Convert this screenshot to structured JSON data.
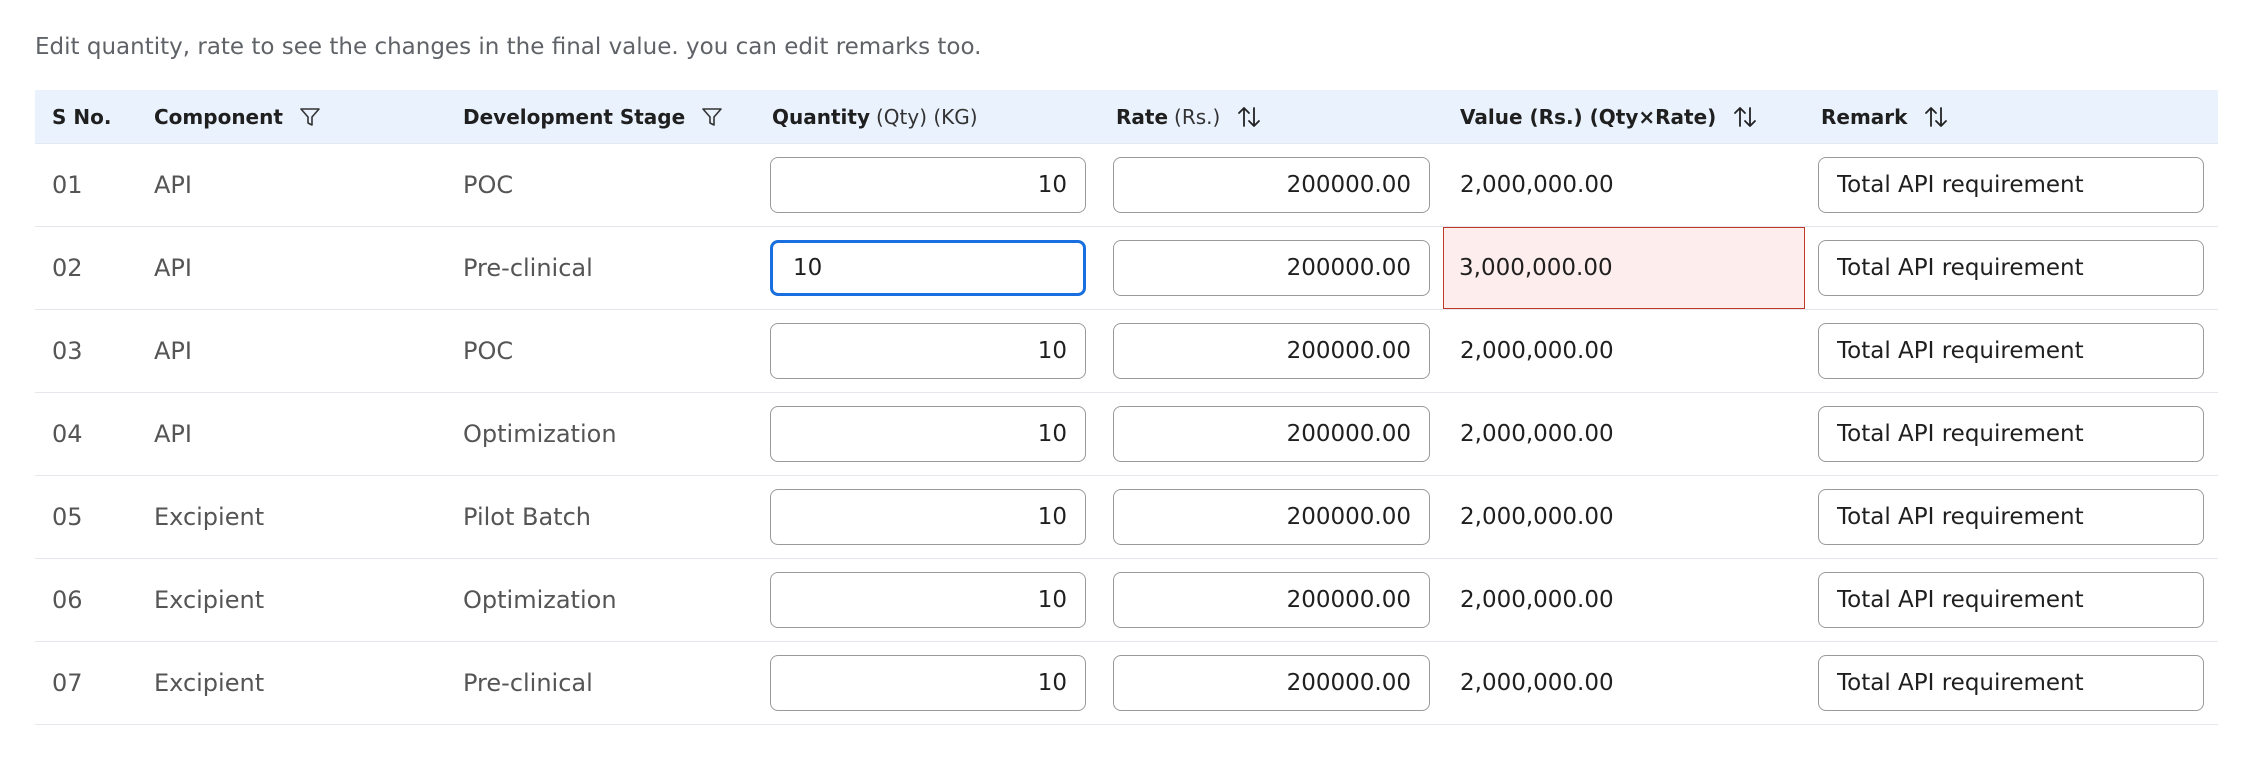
{
  "instructions": "Edit quantity, rate to see the changes in the final value. you can edit remarks too.",
  "columns": {
    "sno": "S No.",
    "component": "Component",
    "stage": "Development Stage",
    "quantity": "Quantity",
    "quantity_unit": "(Qty) (KG)",
    "rate": "Rate",
    "rate_unit": "(Rs.)",
    "value": "Value (Rs.) (Qty×Rate)",
    "remark": "Remark"
  },
  "accent_colors": {
    "header_bg": "#e9f2fd",
    "focus_border": "#1a6fe0",
    "error_border": "#c0392b",
    "error_bg": "#fdeeed"
  },
  "rows": [
    {
      "sno": "01",
      "component": "API",
      "stage": "POC",
      "quantity": "10",
      "rate": "200000.00",
      "value": "2,000,000.00",
      "remark": "Total API requirement",
      "focused": false,
      "error": false
    },
    {
      "sno": "02",
      "component": "API",
      "stage": "Pre-clinical",
      "quantity": "10",
      "rate": "200000.00",
      "value": "3,000,000.00",
      "remark": "Total API requirement",
      "focused": true,
      "error": true
    },
    {
      "sno": "03",
      "component": "API",
      "stage": "POC",
      "quantity": "10",
      "rate": "200000.00",
      "value": "2,000,000.00",
      "remark": "Total API requirement",
      "focused": false,
      "error": false
    },
    {
      "sno": "04",
      "component": "API",
      "stage": "Optimization",
      "quantity": "10",
      "rate": "200000.00",
      "value": "2,000,000.00",
      "remark": "Total API requirement",
      "focused": false,
      "error": false
    },
    {
      "sno": "05",
      "component": "Excipient",
      "stage": "Pilot Batch",
      "quantity": "10",
      "rate": "200000.00",
      "value": "2,000,000.00",
      "remark": "Total API requirement",
      "focused": false,
      "error": false
    },
    {
      "sno": "06",
      "component": "Excipient",
      "stage": "Optimization",
      "quantity": "10",
      "rate": "200000.00",
      "value": "2,000,000.00",
      "remark": "Total API requirement",
      "focused": false,
      "error": false
    },
    {
      "sno": "07",
      "component": "Excipient",
      "stage": "Pre-clinical",
      "quantity": "10",
      "rate": "200000.00",
      "value": "2,000,000.00",
      "remark": "Total API requirement",
      "focused": false,
      "error": false
    }
  ]
}
